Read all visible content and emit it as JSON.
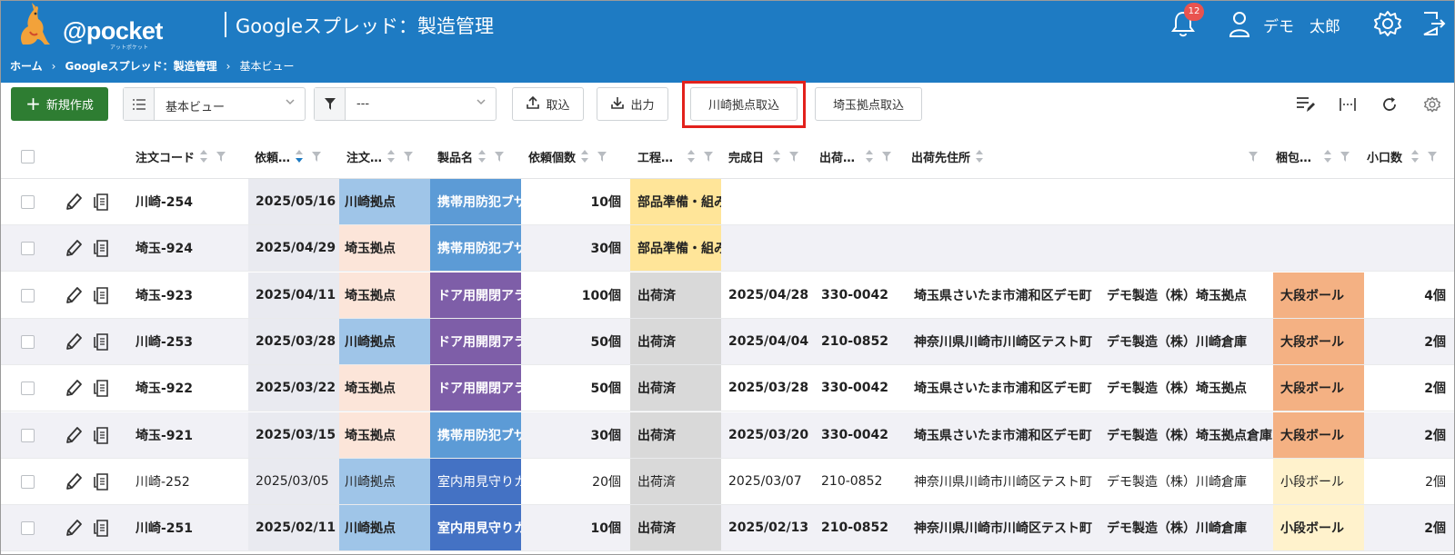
{
  "header": {
    "logo_text": "@pocket",
    "logo_sub": "アットポケット",
    "app_title": "Googleスプレッド：製造管理",
    "breadcrumb": [
      "ホーム",
      "Googleスプレッド：製造管理",
      "基本ビュー"
    ],
    "breadcrumb_sep": "›",
    "notification_count": "12",
    "user_name": "デモ　太郎"
  },
  "toolbar": {
    "new_label": "新規作成",
    "view_select": "基本ビュー",
    "filter_select": "---",
    "import_label": "取込",
    "export_label": "出力",
    "kawasaki_import_label": "川崎拠点取込",
    "saitama_import_label": "埼玉拠点取込"
  },
  "table": {
    "columns": [
      "注文コード",
      "依頼…",
      "注文…",
      "製品名",
      "依頼個数",
      "工程…",
      "完成日",
      "出荷…",
      "出荷先住所",
      "梱包…",
      "小口数"
    ],
    "rows": [
      {
        "code": "川崎-254",
        "req_date": "2025/05/16",
        "branch": "川崎拠点",
        "product": "携帯用防犯ブザー",
        "qty": "10個",
        "process": "部品準備・組み立て",
        "done": "",
        "zip": "",
        "address": "",
        "company": "",
        "pack": "",
        "units": "",
        "bold": true
      },
      {
        "code": "埼玉-924",
        "req_date": "2025/04/29",
        "branch": "埼玉拠点",
        "product": "携帯用防犯ブザー",
        "qty": "30個",
        "process": "部品準備・組み立て",
        "done": "",
        "zip": "",
        "address": "",
        "company": "",
        "pack": "",
        "units": "",
        "bold": true
      },
      {
        "code": "埼玉-923",
        "req_date": "2025/04/11",
        "branch": "埼玉拠点",
        "product": "ドア用開閉アラーム",
        "qty": "100個",
        "process": "出荷済",
        "done": "2025/04/28",
        "zip": "330-0042",
        "address": "埼玉県さいたま市浦和区デモ町",
        "company": "デモ製造（株）埼玉拠点",
        "pack": "大段ボール",
        "units": "4個",
        "bold": true
      },
      {
        "code": "川崎-253",
        "req_date": "2025/03/28",
        "branch": "川崎拠点",
        "product": "ドア用開閉アラーム",
        "qty": "50個",
        "process": "出荷済",
        "done": "2025/04/04",
        "zip": "210-0852",
        "address": "神奈川県川崎市川崎区テスト町",
        "company": "デモ製造（株）川崎倉庫",
        "pack": "大段ボール",
        "units": "2個",
        "bold": true
      },
      {
        "code": "埼玉-922",
        "req_date": "2025/03/22",
        "branch": "埼玉拠点",
        "product": "ドア用開閉アラーム",
        "qty": "50個",
        "process": "出荷済",
        "done": "2025/03/28",
        "zip": "330-0042",
        "address": "埼玉県さいたま市浦和区デモ町",
        "company": "デモ製造（株）埼玉拠点",
        "pack": "大段ボール",
        "units": "2個",
        "bold": true
      },
      {
        "code": "埼玉-921",
        "req_date": "2025/03/15",
        "branch": "埼玉拠点",
        "product": "携帯用防犯ブザー",
        "qty": "30個",
        "process": "出荷済",
        "done": "2025/03/20",
        "zip": "330-0042",
        "address": "埼玉県さいたま市浦和区デモ町",
        "company": "デモ製造（株）埼玉拠点倉庫",
        "pack": "大段ボール",
        "units": "2個",
        "bold": true
      },
      {
        "code": "川崎-252",
        "req_date": "2025/03/05",
        "branch": "川崎拠点",
        "product": "室内用見守りカメラ",
        "qty": "20個",
        "process": "出荷済",
        "done": "2025/03/07",
        "zip": "210-0852",
        "address": "神奈川県川崎市川崎区テスト町",
        "company": "デモ製造（株）川崎倉庫",
        "pack": "小段ボール",
        "units": "2個",
        "bold": false
      },
      {
        "code": "川崎-251",
        "req_date": "2025/02/11",
        "branch": "川崎拠点",
        "product": "室内用見守りカメラ",
        "qty": "10個",
        "process": "出荷済",
        "done": "2025/02/13",
        "zip": "210-0852",
        "address": "神奈川県川崎市川崎区テスト町",
        "company": "デモ製造（株）川崎倉庫",
        "pack": "小段ボール",
        "units": "2個",
        "bold": true
      }
    ]
  },
  "colors": {
    "header_bg": "#1e7bc3",
    "new_button": "#2e7d32",
    "highlight_border": "#e2211c",
    "branch_kawasaki": "#9fc5e8",
    "branch_saitama": "#fce5d9",
    "product_buzzer": "#5c9bd6",
    "product_door": "#7e5ea8",
    "product_camera": "#4472c4",
    "process_prep": "#ffe599",
    "process_shipped": "#d9d9d9",
    "pack_large": "#f4b183",
    "pack_small": "#fff2cc"
  }
}
